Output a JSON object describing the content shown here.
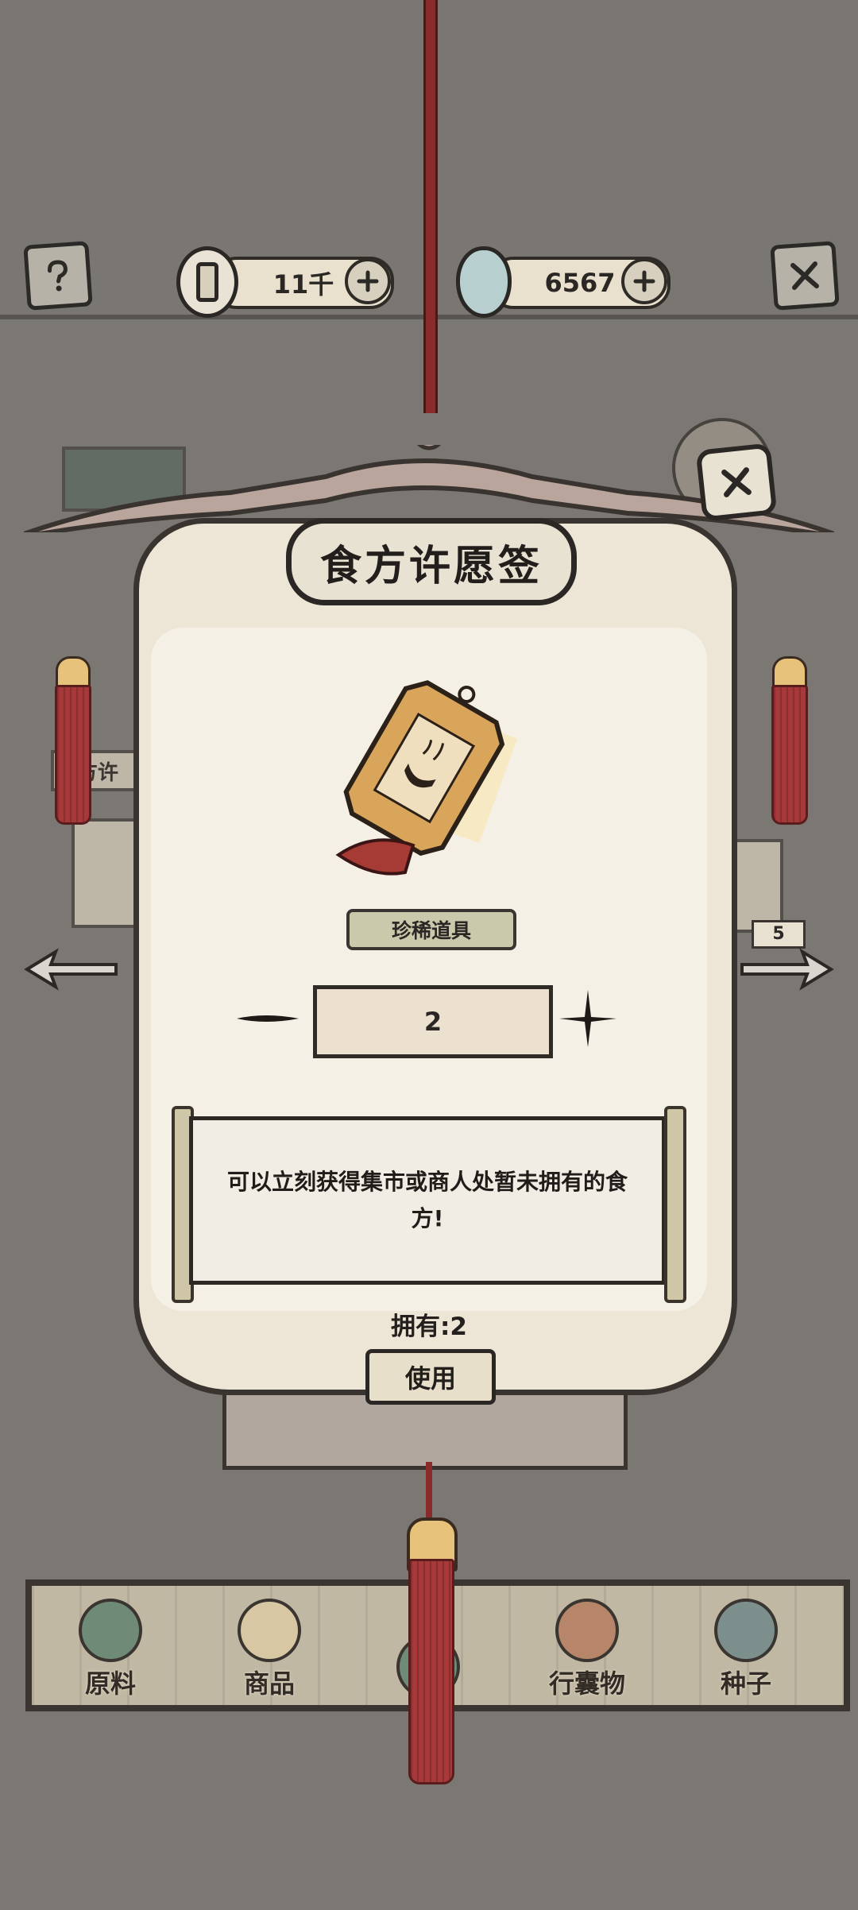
{
  "topbar": {
    "copper_value": "11千",
    "jade_value": "6567"
  },
  "panel": {
    "title": "食方许愿签",
    "rarity": "珍稀道具",
    "quantity": "2",
    "description": "可以立刻获得集市或商人处暂未拥有的食方!",
    "owned": "拥有:2",
    "use_label": "使用"
  },
  "background": {
    "left_label": "方许",
    "right_count": "5"
  },
  "tabs": [
    {
      "label": "原料",
      "icon": "leaf-icon"
    },
    {
      "label": "商品",
      "icon": "goods-icon"
    },
    {
      "label": "",
      "icon": "scroll-icon"
    },
    {
      "label": "行囊物",
      "icon": "clothes-icon"
    },
    {
      "label": "种子",
      "icon": "seed-pot-icon"
    }
  ],
  "colors": {
    "background": "#7b7874",
    "paper": "#ede6d6",
    "ink": "#2b2724",
    "tassel_red": "#a8393a"
  }
}
